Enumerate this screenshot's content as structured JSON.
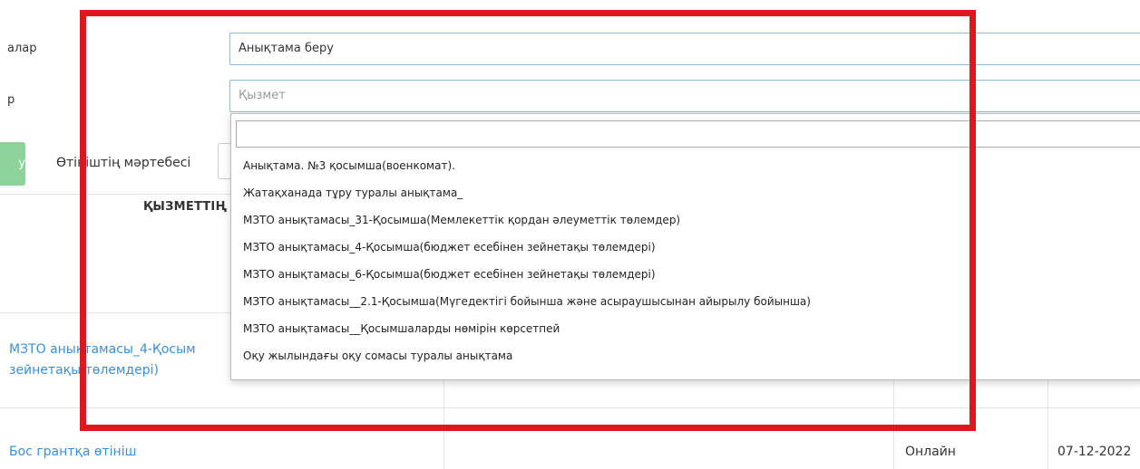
{
  "form": {
    "type_label": "алар",
    "type_value": "Анықтама беру",
    "service_label": "р",
    "service_placeholder": "Қызмет",
    "filter_button_label": "у",
    "status_label": "Өтініштің мәртебесі"
  },
  "table": {
    "header": "ҚЫЗМЕТТІҢ",
    "rows": [
      {
        "name_line1": "МЗТО анықтамасы_4-Қосым",
        "name_line2": "зейнетақы төлемдері)"
      },
      {
        "name_line1": "Бос грантқа өтініш",
        "channel": "Онлайн",
        "date": "07-12-2022"
      }
    ]
  },
  "dropdown": {
    "search_value": "",
    "options": [
      "Анықтама. №3 қосымша(военкомат).",
      "Жатақханада тұру туралы анықтама_",
      "МЗТО анықтамасы_31-Қосымша(Мемлекеттік қордан әлеуметтік төлемдер)",
      "МЗТО анықтамасы_4-Қосымша(бюджет есебінен зейнетақы төлемдері)",
      "МЗТО анықтамасы_6-Қосымша(бюджет есебінен зейнетақы төлемдері)",
      "МЗТО анықтамасы__2.1-Қосымша(Мүгедектігі бойынша және асыраушысынан айырылу бойынша)",
      "МЗТО анықтамасы__Қосымшаларды нөмірін көрсетпей",
      "Оқу жылындағы оқу сомасы туралы анықтама"
    ]
  },
  "colors": {
    "highlight_frame": "#e0161e",
    "link": "#3b8fd6",
    "filter_button": "#8ed39a",
    "field_border": "#8fb7d8"
  }
}
